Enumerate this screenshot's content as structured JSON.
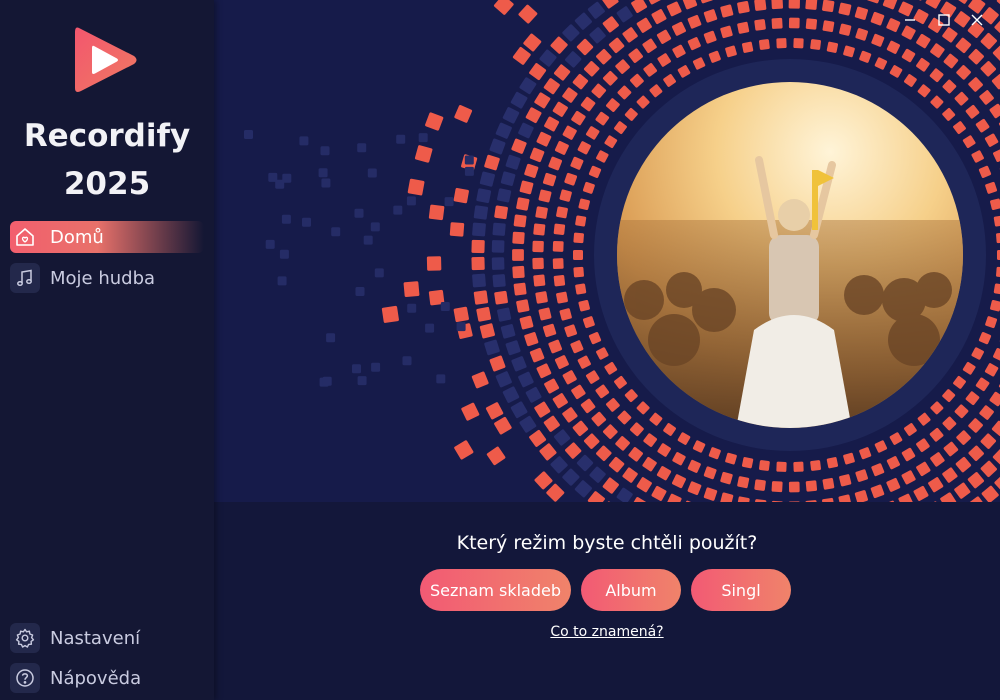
{
  "app": {
    "title": "Recordify 2025",
    "title_line1": "Recordify",
    "title_line2": "2025",
    "accent_color": "#f25f6e"
  },
  "sidebar": {
    "items": [
      {
        "label": "Domů",
        "icon": "home-heart-icon",
        "active": true
      },
      {
        "label": "Moje hudba",
        "icon": "music-note-icon",
        "active": false
      }
    ],
    "bottom_items": [
      {
        "label": "Nastavení",
        "icon": "gear-icon"
      },
      {
        "label": "Nápověda",
        "icon": "question-icon"
      }
    ]
  },
  "window_controls": {
    "minimize": "minimize-icon",
    "maximize": "maximize-icon",
    "close": "close-icon"
  },
  "main": {
    "question": "Který režim byste chtěli použít?",
    "buttons": [
      {
        "label": "Seznam skladeb"
      },
      {
        "label": "Album"
      },
      {
        "label": "Singl"
      }
    ],
    "help_link": "Co to znamená?"
  }
}
